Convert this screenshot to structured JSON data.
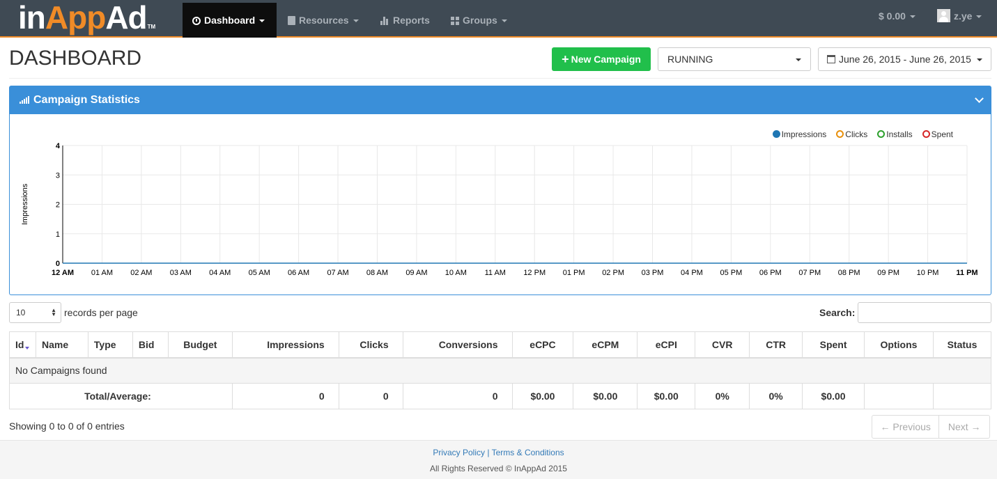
{
  "brand": {
    "name_prefix": "in",
    "name_app": "App",
    "name_suffix": "Ad",
    "tm": "TM"
  },
  "nav": {
    "dashboard": "Dashboard",
    "resources": "Resources",
    "reports": "Reports",
    "groups": "Groups",
    "balance": "$ 0.00",
    "user": "z.ye"
  },
  "header": {
    "title": "DASHBOARD",
    "new_campaign": "New Campaign",
    "status_selected": "RUNNING",
    "date_range": "June 26, 2015 - June 26, 2015"
  },
  "panel": {
    "title": "Campaign Statistics"
  },
  "legend": [
    {
      "label": "Impressions",
      "color": "#1f77b4",
      "filled": true
    },
    {
      "label": "Clicks",
      "color": "#e8900c",
      "filled": false
    },
    {
      "label": "Installs",
      "color": "#2ca02c",
      "filled": false
    },
    {
      "label": "Spent",
      "color": "#d62728",
      "filled": false
    }
  ],
  "chart_data": {
    "type": "line",
    "ylabel": "Impressions",
    "xlabel": "",
    "ylim": [
      0,
      4
    ],
    "yticks": [
      "0",
      "1",
      "2",
      "3",
      "4"
    ],
    "x": [
      "12 AM",
      "01 AM",
      "02 AM",
      "03 AM",
      "04 AM",
      "05 AM",
      "06 AM",
      "07 AM",
      "08 AM",
      "09 AM",
      "10 AM",
      "11 AM",
      "12 PM",
      "01 PM",
      "02 PM",
      "03 PM",
      "04 PM",
      "05 PM",
      "06 PM",
      "07 PM",
      "08 PM",
      "09 PM",
      "10 PM",
      "11 PM"
    ],
    "series": [
      {
        "name": "Impressions",
        "values": [
          0,
          0,
          0,
          0,
          0,
          0,
          0,
          0,
          0,
          0,
          0,
          0,
          0,
          0,
          0,
          0,
          0,
          0,
          0,
          0,
          0,
          0,
          0,
          0
        ]
      }
    ],
    "grid": true,
    "legend_position": "top-right"
  },
  "table_controls": {
    "page_length": "10",
    "length_label": "records per page",
    "search_label": "Search:"
  },
  "table": {
    "columns": [
      "Id",
      "Name",
      "Type",
      "Bid",
      "Budget",
      "Impressions",
      "Clicks",
      "Conversions",
      "eCPC",
      "eCPM",
      "eCPI",
      "CVR",
      "CTR",
      "Spent",
      "Options",
      "Status"
    ],
    "empty_message": "No Campaigns found",
    "totals": {
      "label": "Total/Average:",
      "impressions": "0",
      "clicks": "0",
      "conversions": "0",
      "ecpc": "$0.00",
      "ecpm": "$0.00",
      "ecpi": "$0.00",
      "cvr": "0%",
      "ctr": "0%",
      "spent": "$0.00"
    }
  },
  "info": "Showing 0 to 0 of 0 entries",
  "pager": {
    "previous": "← Previous",
    "next": "Next →"
  },
  "footer": {
    "privacy": "Privacy Policy",
    "sep": "|",
    "terms": "Terms & Conditions",
    "copyright": "All Rights Reserved © InAppAd 2015"
  }
}
